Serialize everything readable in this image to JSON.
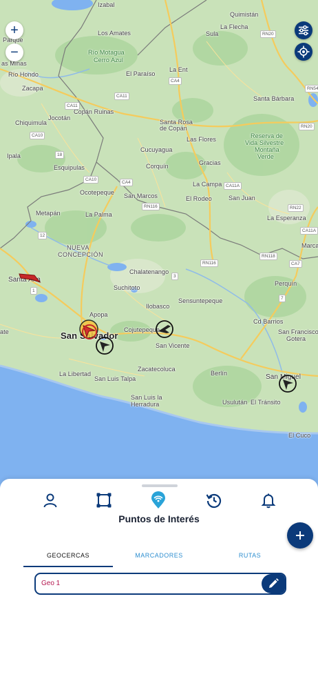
{
  "map": {
    "labels": {
      "izabal": "Izabal",
      "los_amates": "Los Amates",
      "parque": "Parque",
      "las_minas": "as Minas",
      "rio_motagua": "Río Motagua",
      "cerro_azul": "Cerro Azul",
      "el_paraiso": "El Paraíso",
      "la_ent": "La Ent",
      "rio_hondo": "Río Hondo",
      "zacapa": "Zacapa",
      "quimistan": "Quimistán",
      "la_flecha": "La Flecha",
      "sula": "Sula",
      "santa_barbara": "Santa Bárbara",
      "chiquimula": "Chiquimula",
      "jocotan": "Jocotán",
      "copan_ruinas": "Copán Ruinas",
      "santa_rosa_copan_1": "Santa Rosa",
      "santa_rosa_copan_2": "de Copán",
      "reserva_1": "Reserva de",
      "reserva_2": "Vida Silvestre",
      "reserva_3": "Montaña",
      "reserva_4": "Verde",
      "ipala": "Ipala",
      "cucuyagua": "Cucuyagua",
      "las_flores": "Las Flores",
      "esquipulas": "Esquipulas",
      "corquin": "Corquín",
      "gracias": "Gracias",
      "ocotepeque": "Ocotepeque",
      "san_marcos": "San Marcos",
      "la_campa": "La Campa",
      "el_rodeo": "El Rodeo",
      "san_juan": "San Juan",
      "metapan": "Metapán",
      "la_palma": "La Palma",
      "la_esperanza": "La Esperanza",
      "marcala": "Marcala",
      "nueva_1": "NUEVA",
      "nueva_2": "CONCEPCIÓN",
      "chalatenango": "Chalatenango",
      "santa_ana": "Santa Ana",
      "suchitoto": "Suchitoto",
      "perquin": "Perquín",
      "gotera": "Gotera",
      "ilobasco": "Ilobasco",
      "sensuntepeque": "Sensuntepeque",
      "apopa": "Apopa",
      "cd_barrios": "Cd Barrios",
      "san_salvador": "San Salvador",
      "cojutepeque": "Cojutepeque",
      "san_francisco_1": "San Francisco",
      "san_francisco_2": "Gotera",
      "san_vicente": "San Vicente",
      "ate": "ate",
      "la_libertad": "La Libertad",
      "zacatecoluca": "Zacatecoluca",
      "berlin": "Berlín",
      "san_miguel": "San Miguel",
      "san_luis_talpa": "San Luis Talpa",
      "san_luis_herradura_1": "San Luis la",
      "san_luis_herradura_2": "Herradura",
      "usulutan": "Usulután",
      "el_transito": "El Tránsito",
      "el_cuco": "El Cuco"
    },
    "shields": {
      "rn20_a": "RN20",
      "rn20_b": "RN20",
      "rn54": "RN54",
      "ca4_a": "CA4",
      "ca11_a": "CA11",
      "ca10_a": "CA10",
      "ca11_b": "CA11",
      "ca10_b": "CA10",
      "ca4_b": "CA4",
      "rn116_a": "RN116",
      "ca11a_a": "CA11A",
      "rn22": "RN22",
      "ca11a_b": "CA11A",
      "rn116_b": "RN116",
      "rn118": "RN118",
      "ca7": "CA7",
      "n18": "18",
      "n12": "12",
      "n1": "1",
      "n3": "3",
      "n7": "7"
    },
    "controls": {
      "zoom_in": "+",
      "zoom_out": "−"
    },
    "colors": {
      "land": "#c9e2b9",
      "forest": "#a9d49a",
      "water": "#7fb2f0",
      "road": "#f7d36b",
      "border": "#777777",
      "accent": "#0b3a7a"
    },
    "markers": [
      "vehicle-marker-santa-ana",
      "vehicle-marker-san-salvador-1",
      "vehicle-marker-san-salvador-2",
      "vehicle-marker-san-salvador-3",
      "vehicle-marker-cojutepeque",
      "vehicle-marker-san-miguel"
    ]
  },
  "panel": {
    "nav_icons": [
      "person-icon",
      "square-shape-icon",
      "wifi-pin-icon",
      "history-icon",
      "bell-icon"
    ],
    "title": "Puntos de Interés",
    "tabs": {
      "geocercas": "GEOCERCAS",
      "marcadores": "MARCADORES",
      "rutas": "RUTAS"
    },
    "active_tab": "GEOCERCAS",
    "geocercas": [
      {
        "name": "Geo 1"
      }
    ]
  }
}
